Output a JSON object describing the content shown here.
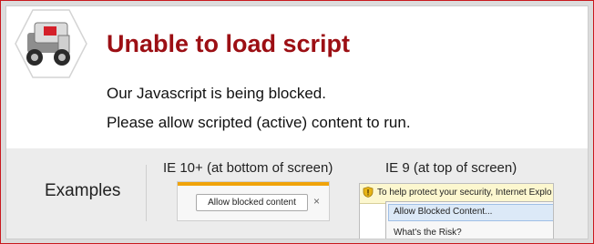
{
  "title": "Unable to load script",
  "messages": {
    "line1": "Our Javascript is being blocked.",
    "line2": "Please allow scripted (active) content to run."
  },
  "examples": {
    "label": "Examples",
    "ie10": {
      "caption": "IE 10+ (at bottom of screen)",
      "button_label": "Allow blocked content",
      "close_glyph": "×"
    },
    "ie9": {
      "caption": "IE 9 (at top of screen)",
      "infobar_text": "To help protect your security, Internet Explo",
      "menu_items": [
        "Allow Blocked Content...",
        "What's the Risk?"
      ]
    }
  },
  "colors": {
    "accent": "#9c0f14",
    "border": "#c9191e",
    "ie10_bar": "#f0a30a",
    "ie9_infobar": "#fcf7cf"
  },
  "icons": {
    "logo": "robot-hexagon-logo",
    "warning": "warning-shield-icon",
    "close": "close-icon"
  }
}
